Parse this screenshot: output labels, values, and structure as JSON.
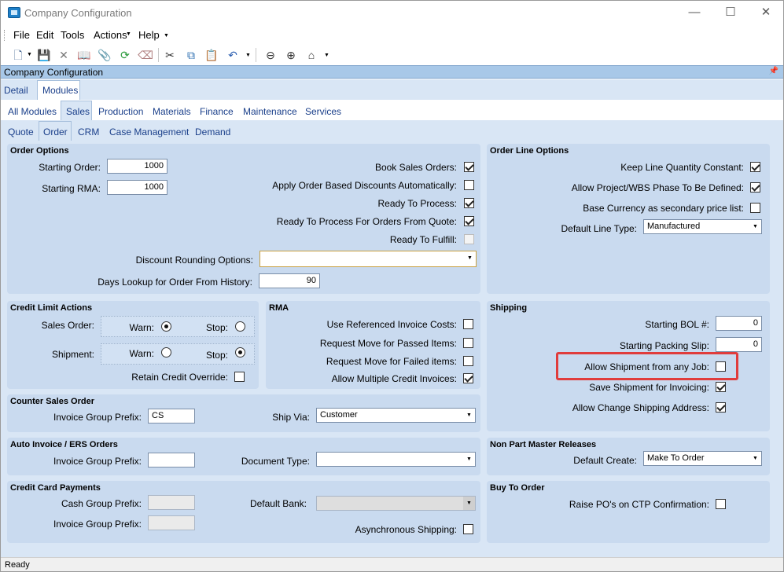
{
  "window": {
    "title": "Company Configuration",
    "min_icon": "minimize-icon",
    "max_icon": "maximize-icon",
    "close_icon": "close-icon"
  },
  "menu": {
    "file": "File",
    "edit": "Edit",
    "tools": "Tools",
    "actions": "Actions",
    "help": "Help"
  },
  "panel": {
    "title": "Company Configuration"
  },
  "tabs": {
    "top": [
      "Detail",
      "Modules"
    ],
    "modules": [
      "All Modules",
      "Sales",
      "Production",
      "Materials",
      "Finance",
      "Maintenance",
      "Services"
    ],
    "sales": [
      "Quote",
      "Order",
      "CRM",
      "Case Management",
      "Demand"
    ]
  },
  "order_options": {
    "title": "Order Options",
    "starting_order_label": "Starting Order:",
    "starting_order": "1000",
    "starting_rma_label": "Starting RMA:",
    "starting_rma": "1000",
    "book_sales_orders": "Book Sales Orders:",
    "apply_discounts": "Apply Order Based Discounts Automatically:",
    "ready_to_process": "Ready To Process:",
    "ready_from_quote": "Ready To Process For Orders From Quote:",
    "ready_to_fulfill": "Ready To Fulfill:",
    "discount_rounding_label": "Discount Rounding Options:",
    "discount_rounding": "",
    "days_lookup_label": "Days Lookup for Order From History:",
    "days_lookup": "90"
  },
  "order_line_options": {
    "title": "Order Line Options",
    "keep_line_qty": "Keep Line Quantity Constant:",
    "allow_project": "Allow Project/WBS Phase To Be Defined:",
    "base_currency": "Base Currency as secondary price list:",
    "default_line_type_label": "Default Line Type:",
    "default_line_type": "Manufactured"
  },
  "credit_limit": {
    "title": "Credit Limit Actions",
    "sales_order": "Sales Order:",
    "shipment": "Shipment:",
    "warn": "Warn:",
    "stop": "Stop:",
    "retain_override": "Retain Credit Override:"
  },
  "rma": {
    "title": "RMA",
    "use_referenced": "Use Referenced Invoice Costs:",
    "request_passed": "Request Move for Passed Items:",
    "request_failed": "Request Move for Failed items:",
    "allow_multiple": "Allow Multiple Credit Invoices:"
  },
  "shipping": {
    "title": "Shipping",
    "starting_bol_label": "Starting BOL #:",
    "starting_bol": "0",
    "starting_packing_label": "Starting Packing Slip:",
    "starting_packing": "0",
    "allow_any_job": "Allow Shipment from any Job:",
    "save_shipment": "Save Shipment for Invoicing:",
    "allow_change_address": "Allow Change Shipping Address:"
  },
  "counter_sales": {
    "title": "Counter Sales Order",
    "invoice_prefix_label": "Invoice Group Prefix:",
    "invoice_prefix": "CS",
    "ship_via_label": "Ship Via:",
    "ship_via": "Customer"
  },
  "auto_invoice": {
    "title": "Auto Invoice / ERS Orders",
    "invoice_prefix_label": "Invoice Group Prefix:",
    "invoice_prefix": "",
    "document_type_label": "Document Type:",
    "document_type": ""
  },
  "non_part": {
    "title": "Non Part Master Releases",
    "default_create_label": "Default Create:",
    "default_create": "Make To Order"
  },
  "credit_card": {
    "title": "Credit Card Payments",
    "cash_prefix_label": "Cash Group Prefix:",
    "cash_prefix": "",
    "invoice_prefix_label": "Invoice Group Prefix:",
    "invoice_prefix": "",
    "default_bank_label": "Default Bank:",
    "default_bank": "",
    "async_shipping": "Asynchronous Shipping:"
  },
  "buy_to_order": {
    "title": "Buy To Order",
    "raise_po": "Raise PO's on CTP Confirmation:"
  },
  "status": {
    "text": "Ready"
  },
  "colors": {
    "accent": "#1a3f8a",
    "panel_bg": "#d9e6f5",
    "group_bg": "#c9daef",
    "highlight": "#e03c3c"
  }
}
